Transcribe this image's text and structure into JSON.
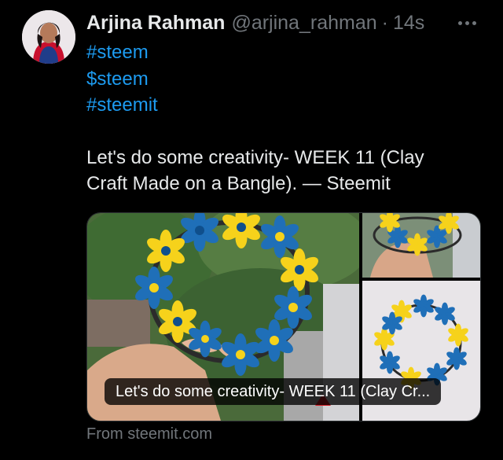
{
  "author": {
    "name": "Arjina Rahman",
    "handle": "@arjina_rahman",
    "separator": "·",
    "time": "14s"
  },
  "tweet": {
    "hashtags": [
      "#steem",
      "$steem",
      "#steemit"
    ],
    "text": "Let's do some creativity- WEEK 11 (Clay Craft Made on a Bangle). — Steemit"
  },
  "card": {
    "caption": "Let's do some creativity- WEEK 11 (Clay Cr...",
    "source": "From steemit.com"
  },
  "colors": {
    "link": "#1d9bf0",
    "muted": "#71767b",
    "text": "#e7e9ea",
    "flower_blue": "#1f6fb8",
    "flower_yellow": "#f6d21b"
  },
  "icons": [
    "more-options-icon"
  ]
}
